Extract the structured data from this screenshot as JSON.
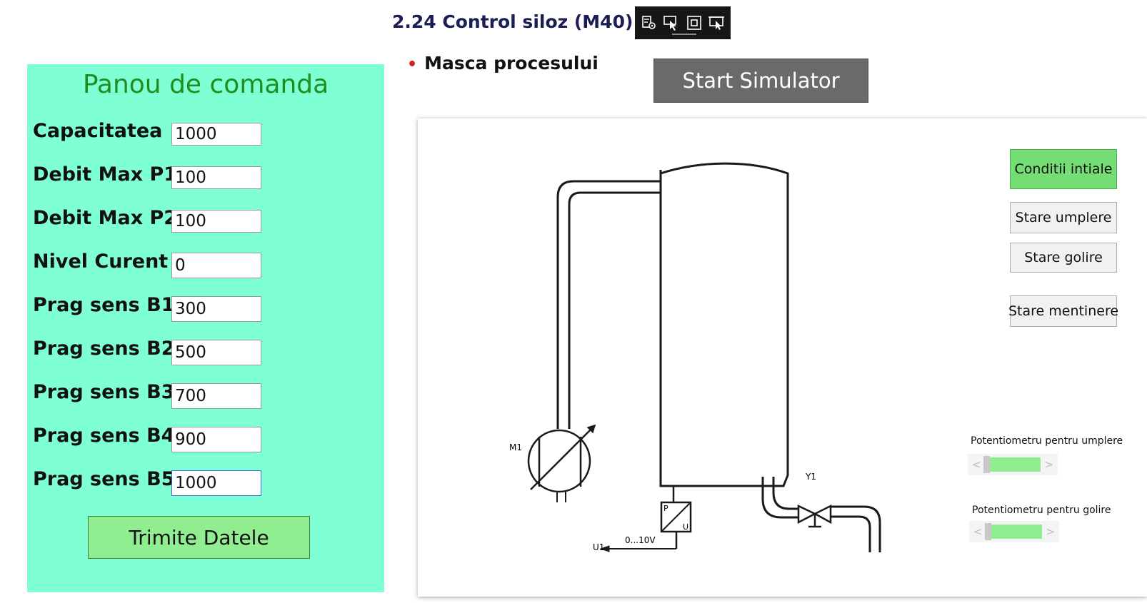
{
  "page": {
    "title": "2.24 Control siloz (M40)",
    "bullet": "Masca procesului"
  },
  "toolbar": {
    "icons": [
      "settings-icon",
      "pointer-icon",
      "fullscreen-icon",
      "pointer-select-icon"
    ]
  },
  "control_panel": {
    "title": "Panou de comanda",
    "fields": [
      {
        "label": "Capacitatea",
        "value": "1000"
      },
      {
        "label": "Debit Max P1",
        "value": "100"
      },
      {
        "label": "Debit Max P2",
        "value": "100"
      },
      {
        "label": "Nivel Curent",
        "value": "0"
      },
      {
        "label": "Prag sens B1",
        "value": "300"
      },
      {
        "label": "Prag sens B2",
        "value": "500"
      },
      {
        "label": "Prag sens B3",
        "value": "700"
      },
      {
        "label": "Prag sens B4",
        "value": "900"
      },
      {
        "label": "Prag sens B5",
        "value": "1000"
      }
    ],
    "submit_label": "Trimite Datele"
  },
  "simulator": {
    "start_label": "Start Simulator",
    "buttons": {
      "initial": "Conditii intiale",
      "fill": "Stare umplere",
      "empty": "Stare golire",
      "hold": "Stare mentinere"
    },
    "diagram": {
      "pump_label": "M1",
      "valve_label": "Y1",
      "output_label": "U1",
      "range_label": "0...10V",
      "sensor_p": "P",
      "sensor_u": "U"
    },
    "potentiometers": {
      "fill_label": "Potentiometru pentru umplere",
      "fill_level": 0,
      "empty_label": "Potentiometru pentru golire",
      "empty_level": 0
    }
  },
  "colors": {
    "panel_bg": "#7fffd4",
    "panel_title": "#1f8e1f",
    "submit_bg": "#90ee90",
    "start_bg": "#6a6a6a",
    "active_button": "#74dd74",
    "bullet": "#d31f1f",
    "title": "#1b1e55"
  }
}
